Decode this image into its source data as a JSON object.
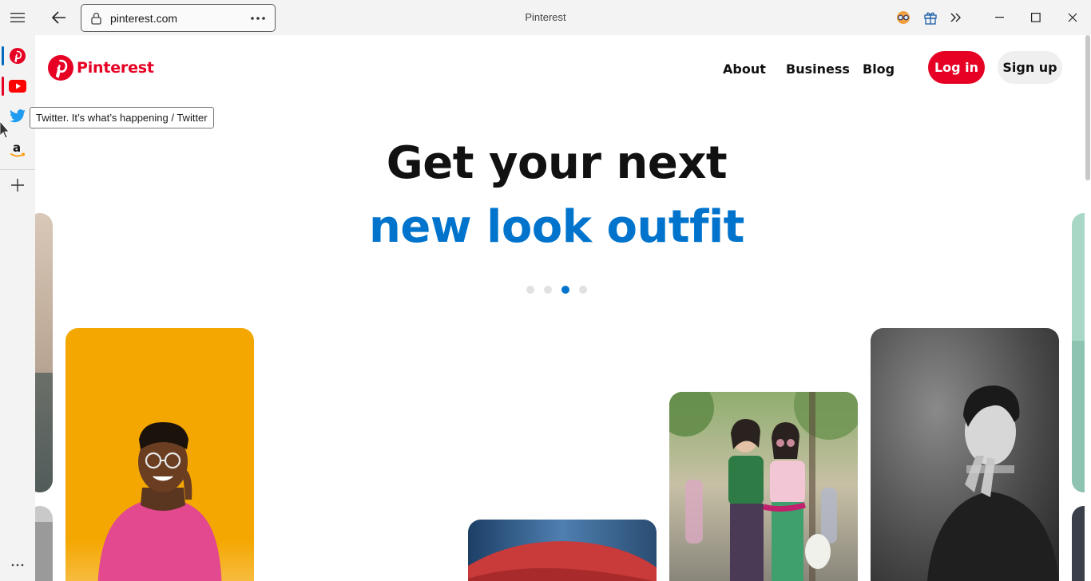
{
  "browser": {
    "address": "pinterest.com",
    "tab_title": "Pinterest",
    "tooltip": "Twitter. It’s what’s happening / Twitter",
    "side_items": [
      {
        "name": "Pinterest",
        "icon": "pinterest-icon",
        "color": "#e60023"
      },
      {
        "name": "YouTube",
        "icon": "youtube-icon",
        "color": "#ff0000"
      },
      {
        "name": "Twitter",
        "icon": "twitter-icon",
        "color": "#1d9bf0"
      },
      {
        "name": "Amazon",
        "icon": "amazon-icon",
        "color": "#111111"
      }
    ]
  },
  "site": {
    "brand": "Pinterest",
    "nav": {
      "about": "About",
      "business": "Business",
      "blog": "Blog"
    },
    "login": "Log in",
    "signup": "Sign up"
  },
  "hero": {
    "line1": "Get your next",
    "line2": "new look outfit",
    "carousel": {
      "count": 4,
      "active_index": 2
    }
  },
  "colors": {
    "brand_red": "#e60023",
    "hero_blue": "#0074cc",
    "chrome_bg": "#f3f3f3"
  }
}
